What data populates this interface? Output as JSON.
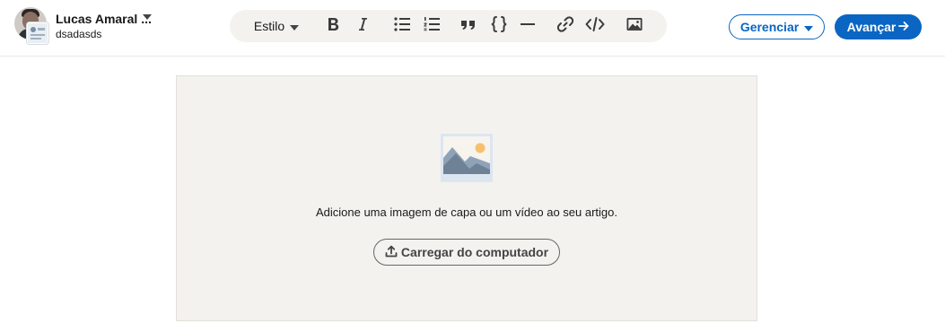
{
  "author": {
    "name": "Lucas Amaral ...",
    "subtitle": "dsadasds"
  },
  "toolbar": {
    "style_label": "Estilo",
    "buttons": [
      {
        "icon": "bold-icon"
      },
      {
        "icon": "italic-icon"
      },
      {
        "icon": "bulleted-list-icon"
      },
      {
        "icon": "numbered-list-icon"
      },
      {
        "icon": "quote-icon"
      },
      {
        "icon": "code-block-icon"
      },
      {
        "icon": "divider-icon"
      },
      {
        "icon": "link-icon"
      },
      {
        "icon": "embed-code-icon"
      },
      {
        "icon": "image-icon"
      }
    ]
  },
  "actions": {
    "manage_label": "Gerenciar",
    "next_label": "Avançar"
  },
  "cover": {
    "message": "Adicione uma imagem de capa ou um vídeo ao seu artigo.",
    "upload_label": "Carregar do computador",
    "illustration": "landscape-image-icon"
  },
  "colors": {
    "accent": "#0a66c2",
    "toolbar_bg": "#f3f2ef",
    "cover_bg": "#f3f2ef",
    "text": "#191919"
  }
}
